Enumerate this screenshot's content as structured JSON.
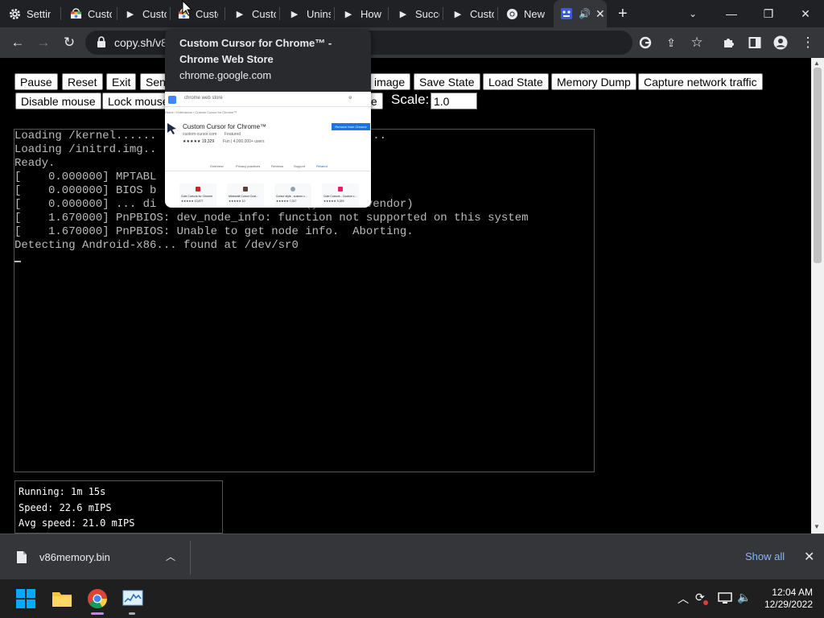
{
  "tabs": [
    {
      "title": "Settin",
      "icon": "gear-icon"
    },
    {
      "title": "Custo",
      "icon": "web-store-icon"
    },
    {
      "title": "Custo",
      "icon": "play-icon"
    },
    {
      "title": "Custo",
      "icon": "web-store-icon"
    },
    {
      "title": "Custo",
      "icon": "play-icon"
    },
    {
      "title": "Unins",
      "icon": "play-icon"
    },
    {
      "title": "How",
      "icon": "play-icon"
    },
    {
      "title": "Succe",
      "icon": "play-icon"
    },
    {
      "title": "Custo",
      "icon": "play-icon"
    },
    {
      "title": "New",
      "icon": "chrome-icon"
    }
  ],
  "toolbar": {
    "url": "copy.sh/v8"
  },
  "hover_card": {
    "title": "Custom Cursor for Chrome™ - Chrome Web Store",
    "domain": "chrome.google.com",
    "preview": {
      "store_name": "chrome web store",
      "breadcrumb": "Home › Extensions › Custom Cursor for Chrome™",
      "ext_name": "Custom Cursor for Chrome™",
      "ext_source": "custom-cursor.com",
      "ext_featured": "Featured",
      "ext_rating": "★★★★★ 19,329",
      "ext_meta": "Fun | 4,000,000+ users",
      "remove_button": "Remove from Chrome",
      "nav": [
        "Overview",
        "Privacy practices",
        "Reviews",
        "Support",
        "Related"
      ],
      "related": [
        {
          "name": "Cute Cursors for Chrome",
          "rating": "★★★★★ 10,877"
        },
        {
          "name": "Minecraft Cursor Cust…",
          "rating": "★★★★★ 10"
        },
        {
          "name": "Cursor style - custom c…",
          "rating": "★★★★★ 7,017"
        },
        {
          "name": "Cute Cursors - Custom c…",
          "rating": "★★★★★ 9,329"
        }
      ]
    }
  },
  "controls": {
    "row1": [
      "Pause",
      "Reset",
      "Exit",
      "Sen",
      "image",
      "Save State",
      "Load State",
      "Memory Dump",
      "Capture network traffic"
    ],
    "row2": [
      "Disable mouse",
      "Lock mouse",
      "te"
    ],
    "scale_label": "Scale:",
    "scale_value": "1.0"
  },
  "terminal": {
    "lines": [
      "Loading /kernel......                                ..",
      "Loading /initrd.img..",
      "Ready.",
      "[    0.000000] MPTABL                                 ",
      "[    0.000000] BIOS b                            !...",
      "[    0.000000] ... di                      (your hw vendor)",
      "[    1.670000] PnPBIOS: dev_node_info: function not supported on this system",
      "[    1.670000] PnPBIOS: Unable to get node info.  Aborting.",
      "Detecting Android-x86... found at /dev/sr0"
    ]
  },
  "stats": {
    "running": "Running: 1m 15s",
    "speed": "Speed: 22.6 mIPS",
    "avg_speed": "Avg speed: 21.0 mIPS"
  },
  "downloads": {
    "file_name": "v86memory.bin",
    "show_all": "Show all"
  },
  "taskbar": {
    "time": "12:04 AM",
    "date": "12/29/2022"
  },
  "colors": {
    "tab_strip": "#202124",
    "toolbar": "#35363a",
    "link": "#8ab4f8",
    "terminal_text": "#bbbbbb"
  }
}
